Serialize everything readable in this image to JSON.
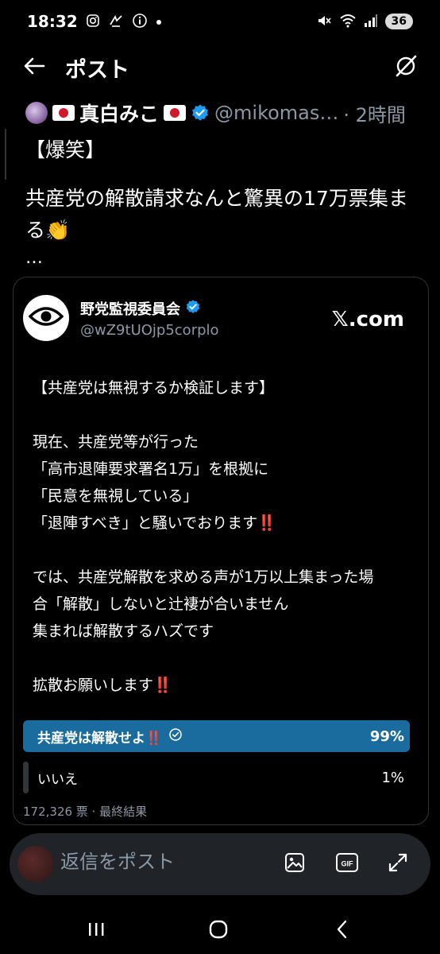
{
  "status_bar": {
    "time": "18:32",
    "battery": "36",
    "left_icons": [
      "instagram-icon",
      "broadcast-icon",
      "info-icon",
      "dot-icon"
    ],
    "right_icons": [
      "mute-icon",
      "wifi-icon",
      "signal-icon",
      "battery-icon"
    ]
  },
  "header": {
    "title": "ポスト"
  },
  "post": {
    "author_name": "真白みこ",
    "handle": "@mikomas…",
    "time": "· 2時間",
    "text_lines": [
      "【爆笑】",
      "共産党の解散請求なんと驚異の17万票集まる👏",
      "…"
    ]
  },
  "card": {
    "name": "野党監視委員会",
    "handle": "@wZ9tUOjp5corplo",
    "source": "𝕏.com",
    "body": {
      "l1": "【共産党は無視するか検証します】",
      "l2": "現在、共産党等が行った",
      "l3": "「高市退陣要求署名1万」を根拠に",
      "l4": "「民意を無視している」",
      "l5": "「退陣すべき」と騒いでおります‼️",
      "l6": "では、共産党解散を求める声が1万以上集まった場",
      "l7": "合「解散」しないと辻褄が合いません",
      "l8": "集まれば解散するハズです",
      "l9": "拡散お願いします‼️"
    },
    "poll": {
      "options": [
        {
          "label": "共産党は解散せよ‼️",
          "percent": "99%",
          "value": 0.99,
          "winner": true
        },
        {
          "label": "いいえ",
          "percent": "1%",
          "value": 0.01,
          "winner": false
        }
      ],
      "meta": "172,326 票 · 最終結果"
    }
  },
  "reply_bar": {
    "placeholder": "返信をポスト"
  },
  "colors": {
    "accent": "#1d9bf0",
    "poll_winner": "#1a6b9e",
    "muted": "#8b98a5"
  }
}
